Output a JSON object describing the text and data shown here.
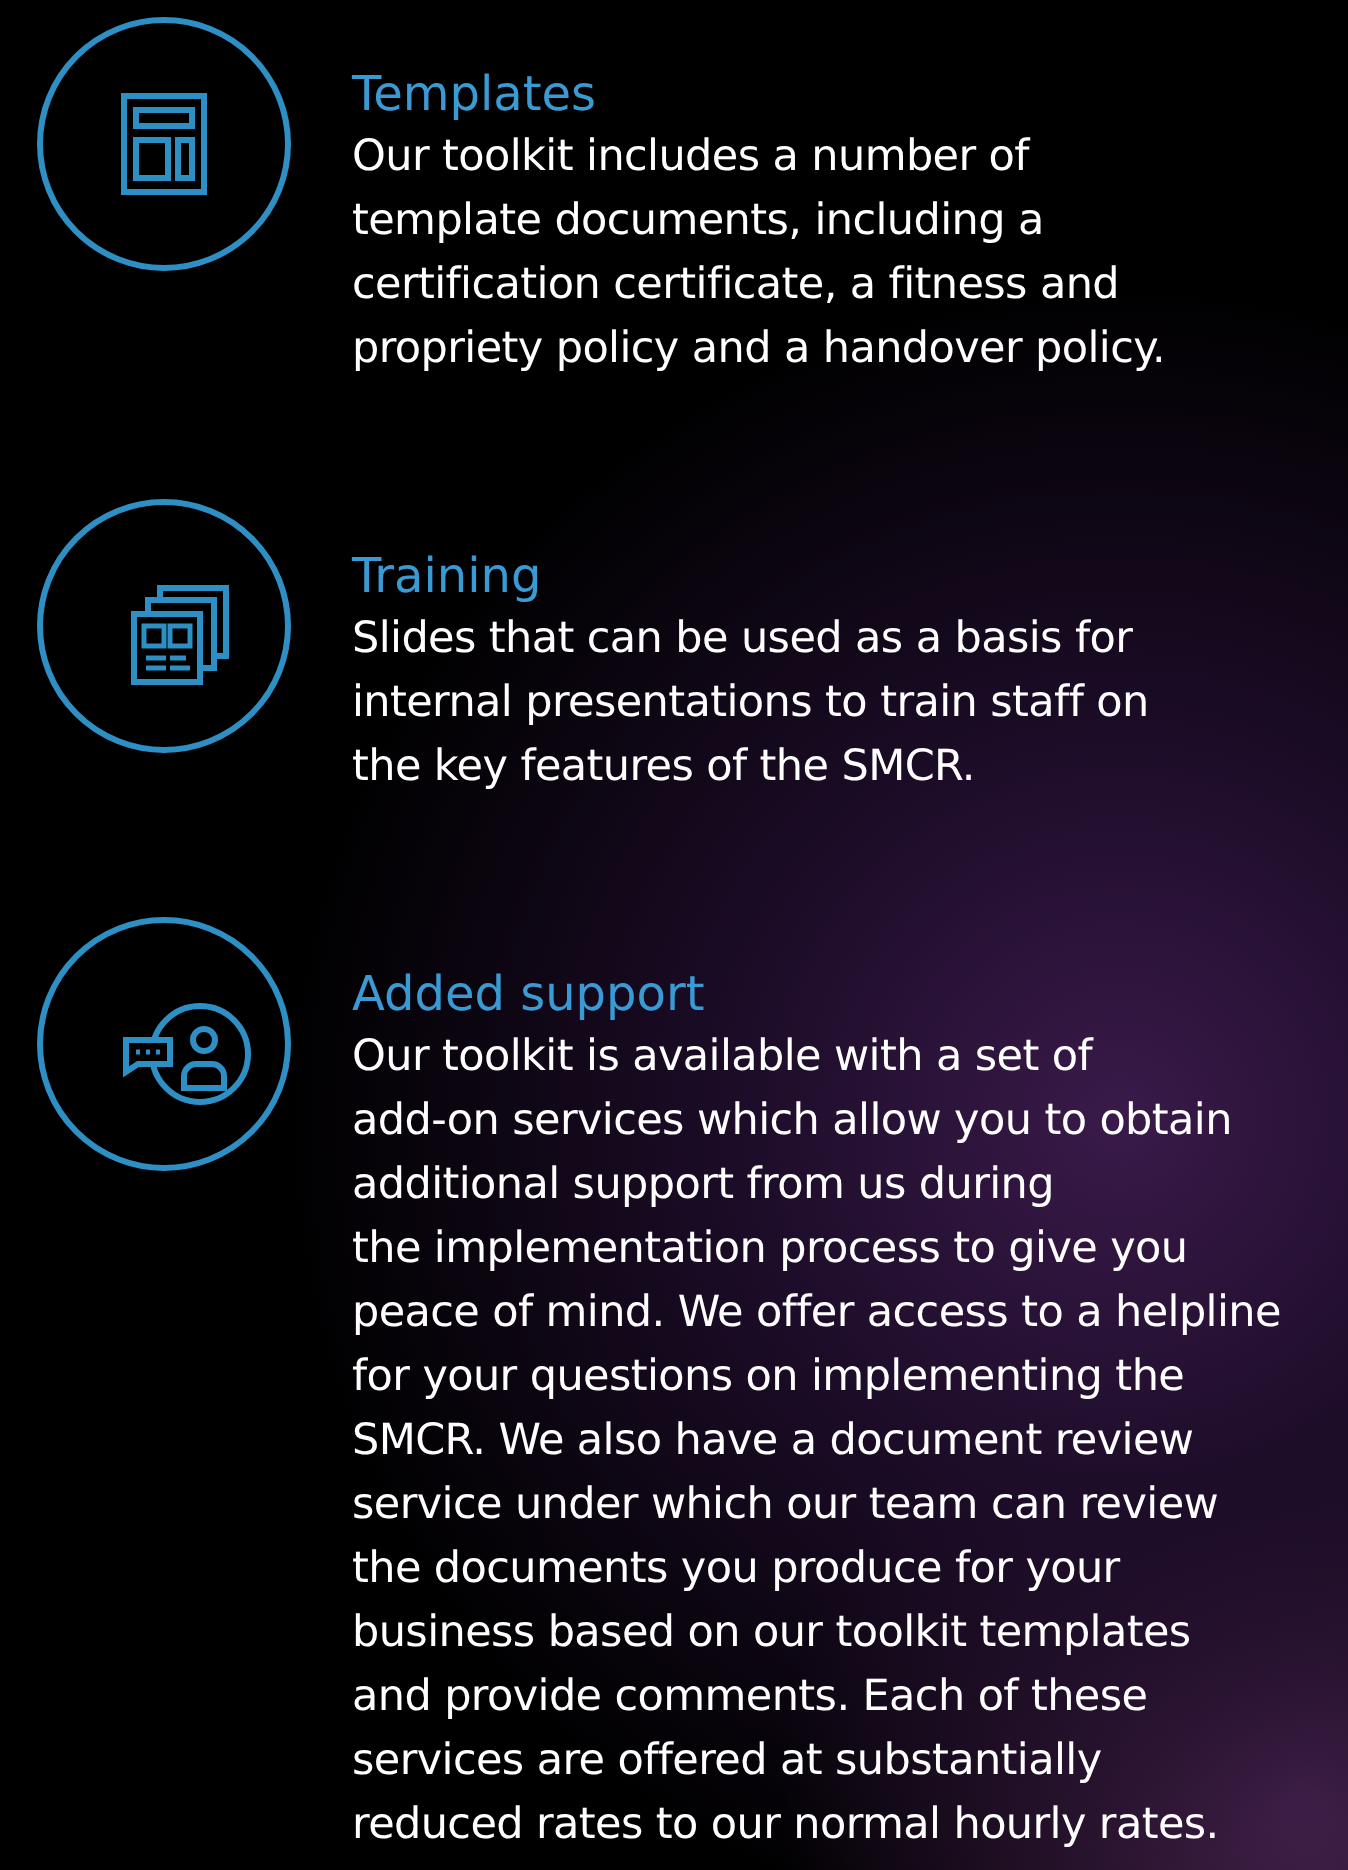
{
  "features": [
    {
      "kind": "templates",
      "title": "Templates",
      "body_lines": [
        "Our toolkit includes a number of",
        "template documents, including a",
        "certification certificate, a fitness and",
        "propriety policy and a handover policy."
      ]
    },
    {
      "kind": "training",
      "title": "Training",
      "body_lines": [
        "Slides that can be used as a basis for",
        "internal presentations to train staff on",
        "the key features of the SMCR."
      ]
    },
    {
      "kind": "support",
      "title": "Added support",
      "body_lines": [
        "Our toolkit is available with a set of",
        "add-on services which allow you to obtain",
        "additional support from us during",
        "the implementation process to give you",
        "peace of mind. We offer access to a helpline",
        "for your questions on implementing the",
        "SMCR. We also have a document review",
        "service under which our team can review",
        "the documents you produce for your",
        "business based on our toolkit templates",
        "and provide comments. Each of these",
        "services are offered at substantially",
        "reduced rates to our normal hourly rates."
      ]
    }
  ]
}
